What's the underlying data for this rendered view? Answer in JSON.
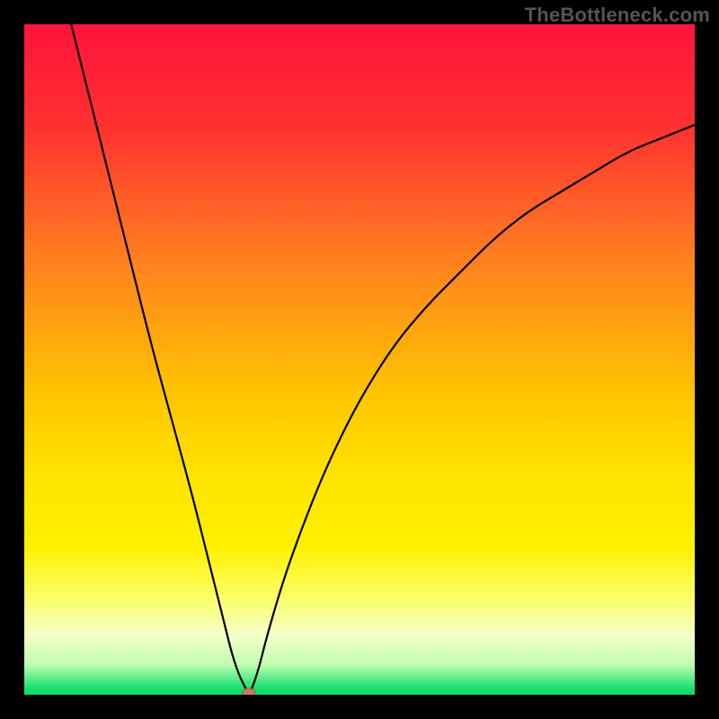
{
  "attribution": "TheBottleneck.com",
  "colors": {
    "black": "#000000",
    "curve": "#000000",
    "marker_fill": "#cc7766",
    "marker_stroke": "#bb5544"
  },
  "gradient_stops": [
    {
      "offset": 0.0,
      "color": "#ff143c"
    },
    {
      "offset": 0.15,
      "color": "#ff3030"
    },
    {
      "offset": 0.35,
      "color": "#ff8020"
    },
    {
      "offset": 0.55,
      "color": "#ffc400"
    },
    {
      "offset": 0.68,
      "color": "#ffe500"
    },
    {
      "offset": 0.78,
      "color": "#fff000"
    },
    {
      "offset": 0.86,
      "color": "#fbff70"
    },
    {
      "offset": 0.91,
      "color": "#f7ffc8"
    },
    {
      "offset": 0.955,
      "color": "#c0ffb0"
    },
    {
      "offset": 0.99,
      "color": "#18e070"
    },
    {
      "offset": 1.0,
      "color": "#10d868"
    }
  ],
  "chart_data": {
    "type": "line",
    "title": "",
    "xlabel": "",
    "ylabel": "",
    "xlim": [
      0,
      100
    ],
    "ylim": [
      0,
      100
    ],
    "x": [
      7,
      10,
      13,
      16,
      19,
      22,
      25,
      28,
      30,
      31,
      32,
      33,
      33.5,
      34,
      35,
      36,
      38,
      40,
      43,
      46,
      50,
      55,
      60,
      65,
      70,
      75,
      80,
      85,
      90,
      95,
      100
    ],
    "values": [
      100,
      88,
      76,
      64,
      52,
      41,
      30,
      18,
      10,
      6,
      3,
      1,
      0,
      1,
      4,
      8,
      15,
      21,
      29,
      36,
      44,
      52,
      58,
      63,
      68,
      72,
      75,
      78,
      81,
      83,
      85
    ],
    "marker": {
      "x": 33.5,
      "y": 0
    },
    "note": "Curve shape is a V/check-mark bottleneck profile with minimum near x≈33.5. Values estimated from pixel positions; no axis ticks or numeric labels are shown in the image."
  }
}
